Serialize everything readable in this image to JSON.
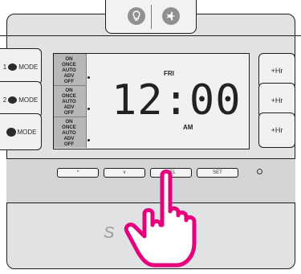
{
  "top_icons": [
    "lightbulb-icon",
    "airplane-icon"
  ],
  "left_buttons": [
    {
      "number": "1",
      "label": "MODE"
    },
    {
      "number": "2",
      "label": "MODE"
    },
    {
      "number": "",
      "label": "MODE"
    }
  ],
  "right_buttons": [
    "+Hr",
    "+Hr",
    "+Hr"
  ],
  "lcd": {
    "mode_blocks": [
      [
        "ON",
        "ONCE",
        "AUTO",
        "ADV",
        "OFF"
      ],
      [
        "ON",
        "ONCE",
        "AUTO",
        "ADV",
        "OFF"
      ],
      [
        "ON",
        "ONCE",
        "AUTO",
        "ADV",
        "OFF"
      ]
    ],
    "day": "FRI",
    "time": "12:00",
    "ampm": "AM"
  },
  "bottom_buttons": [
    "^",
    "v",
    "SEL",
    "SET"
  ],
  "colors": {
    "accent": "#e6007e",
    "lcd": "#f1f1f1",
    "body": "#e1e2e3"
  }
}
